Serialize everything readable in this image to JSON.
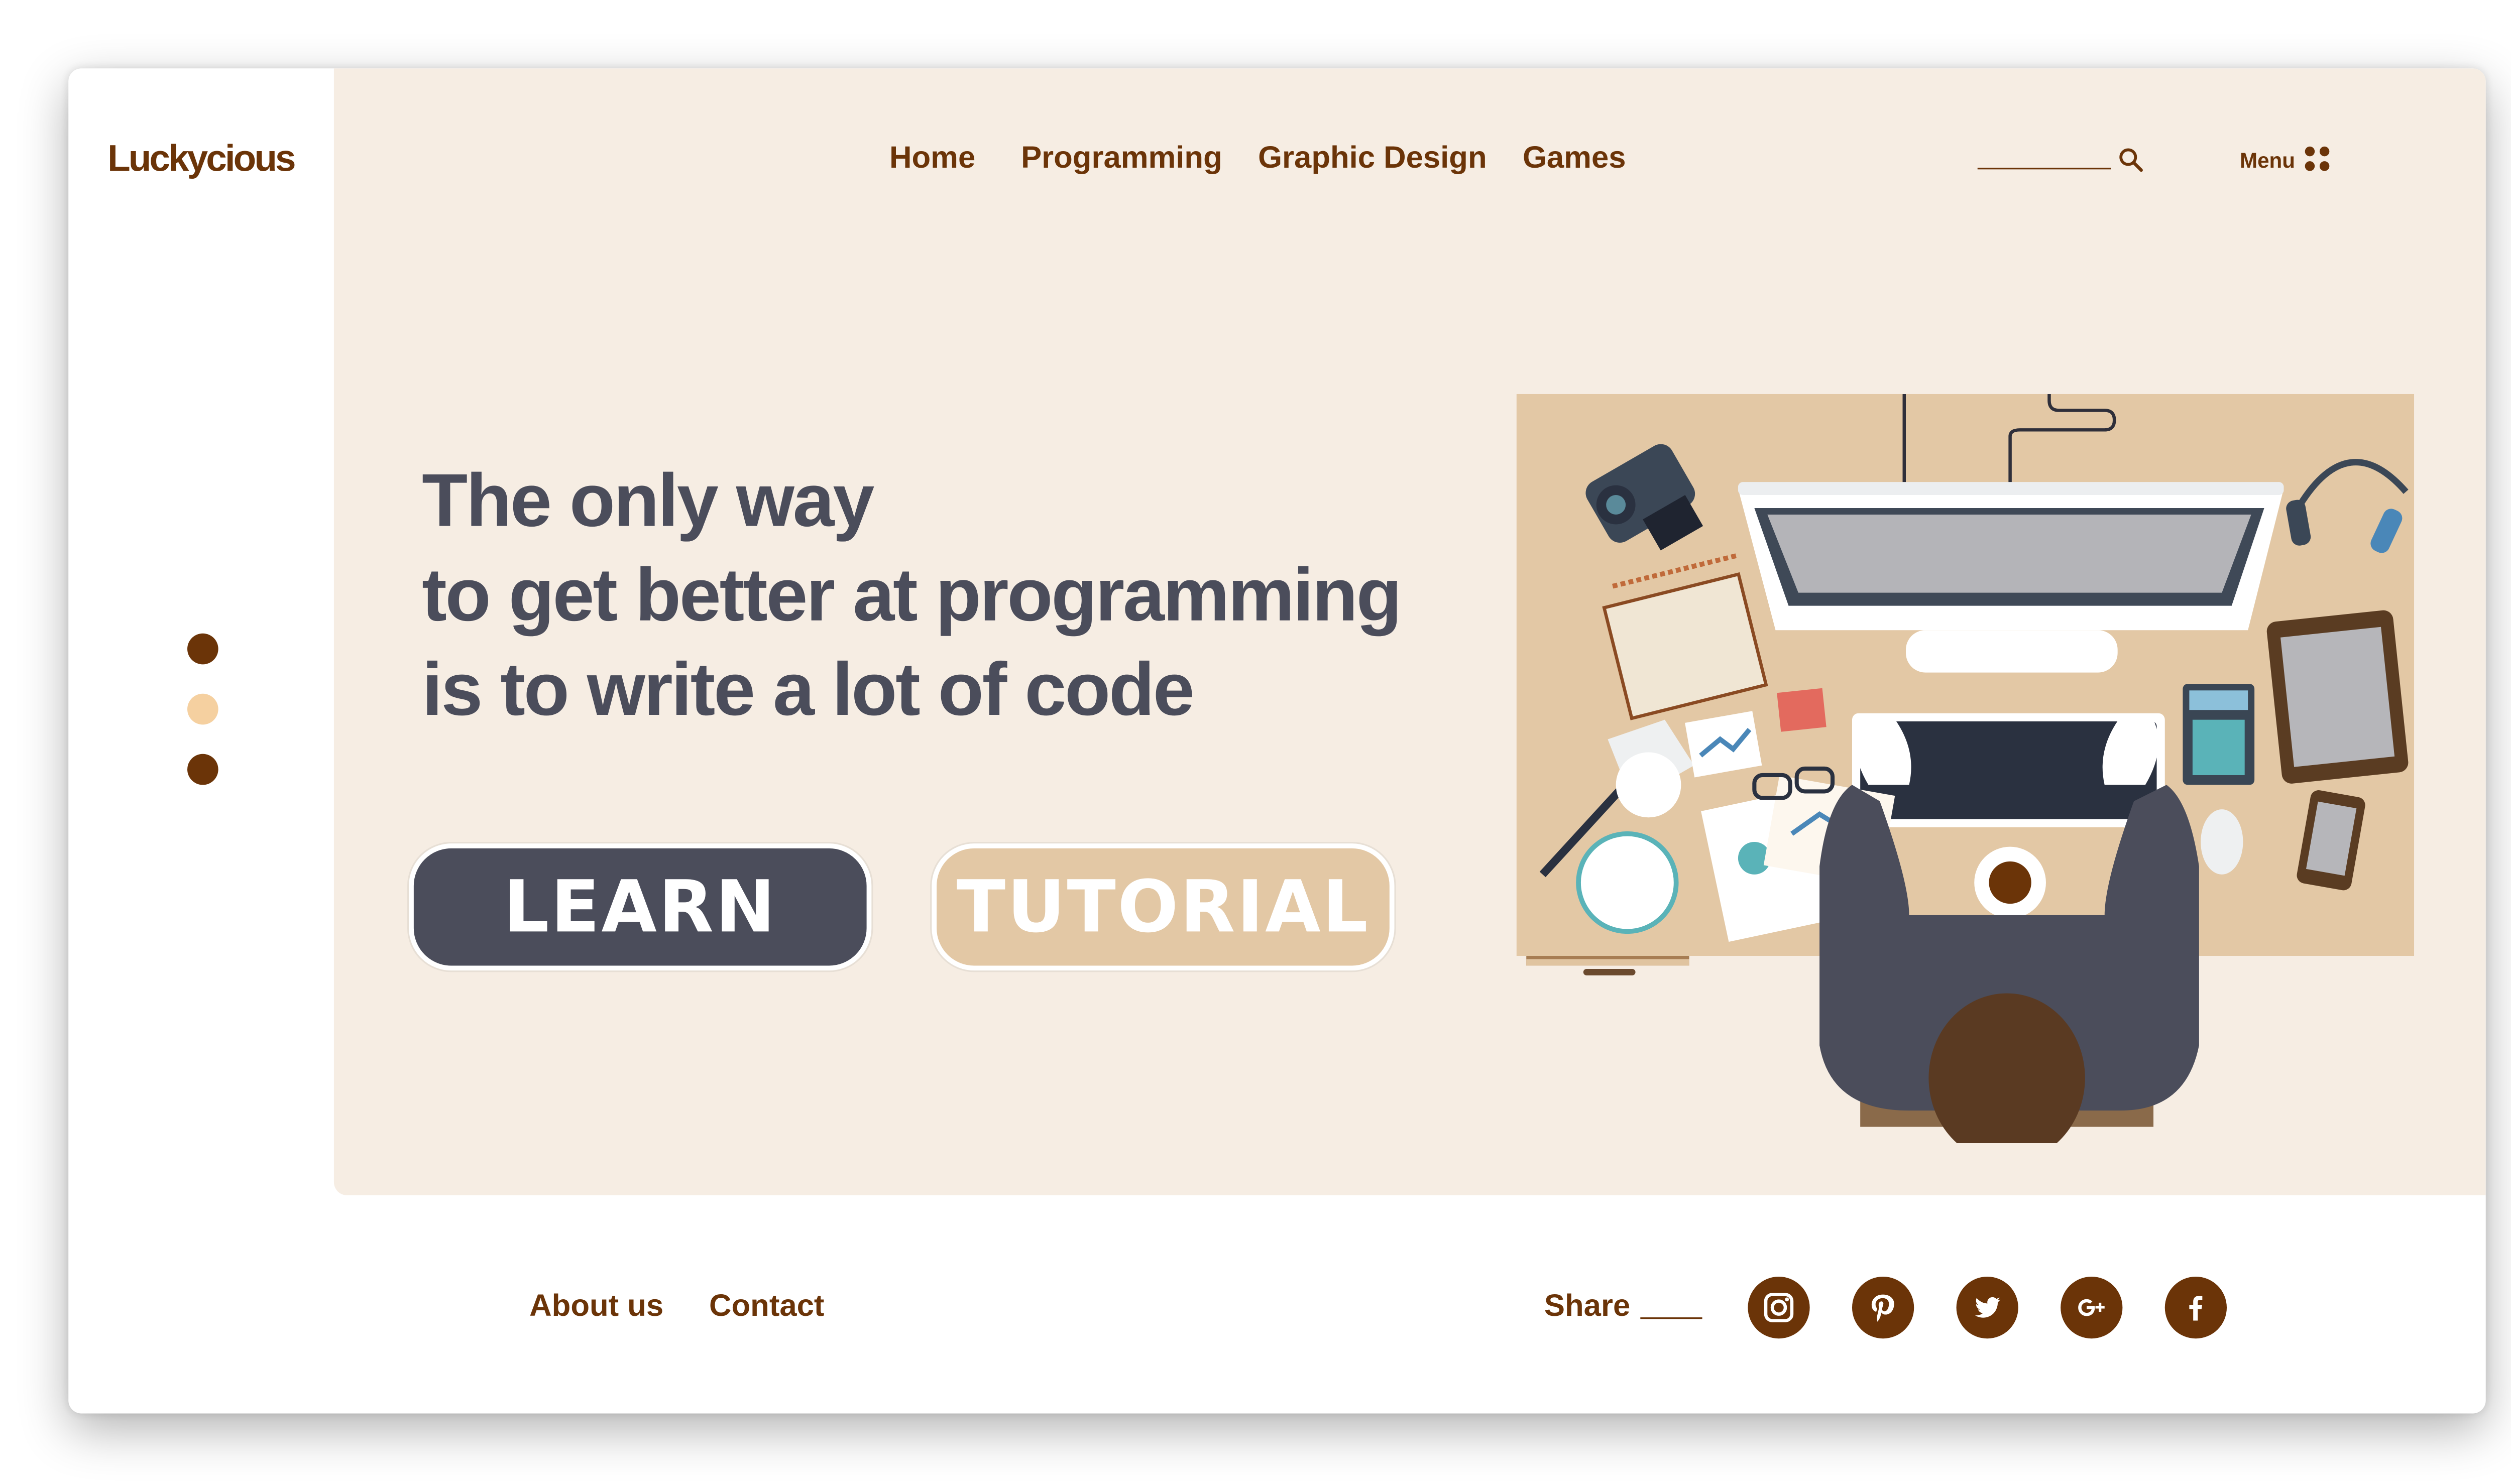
{
  "brand": {
    "logo": "Luckycious"
  },
  "nav": {
    "items": [
      "Home",
      "Programming",
      "Graphic Design",
      "Games"
    ]
  },
  "search": {
    "value": ""
  },
  "menu": {
    "label": "Menu"
  },
  "hero": {
    "headline_lines": [
      "The only way",
      "to get better at programming",
      "is to write a lot of code"
    ],
    "learn_label": "LEARN",
    "tutorial_label": "TUTORIAL",
    "slider": {
      "slides": 3,
      "active_index": 1
    }
  },
  "footer": {
    "links": [
      "About us",
      "Contact"
    ],
    "share_label": "Share",
    "socials": [
      "instagram-icon",
      "pinterest-icon",
      "twitter-icon",
      "google-plus-icon",
      "facebook-icon"
    ]
  },
  "colors": {
    "brand_brown": "#6b3408",
    "hero_bg": "#f6ede3",
    "learn_button": "#4b4d5b",
    "tutorial_button": "#e3c8a5",
    "headline": "#4b4d5b",
    "active_dot": "#f5d0a0"
  }
}
